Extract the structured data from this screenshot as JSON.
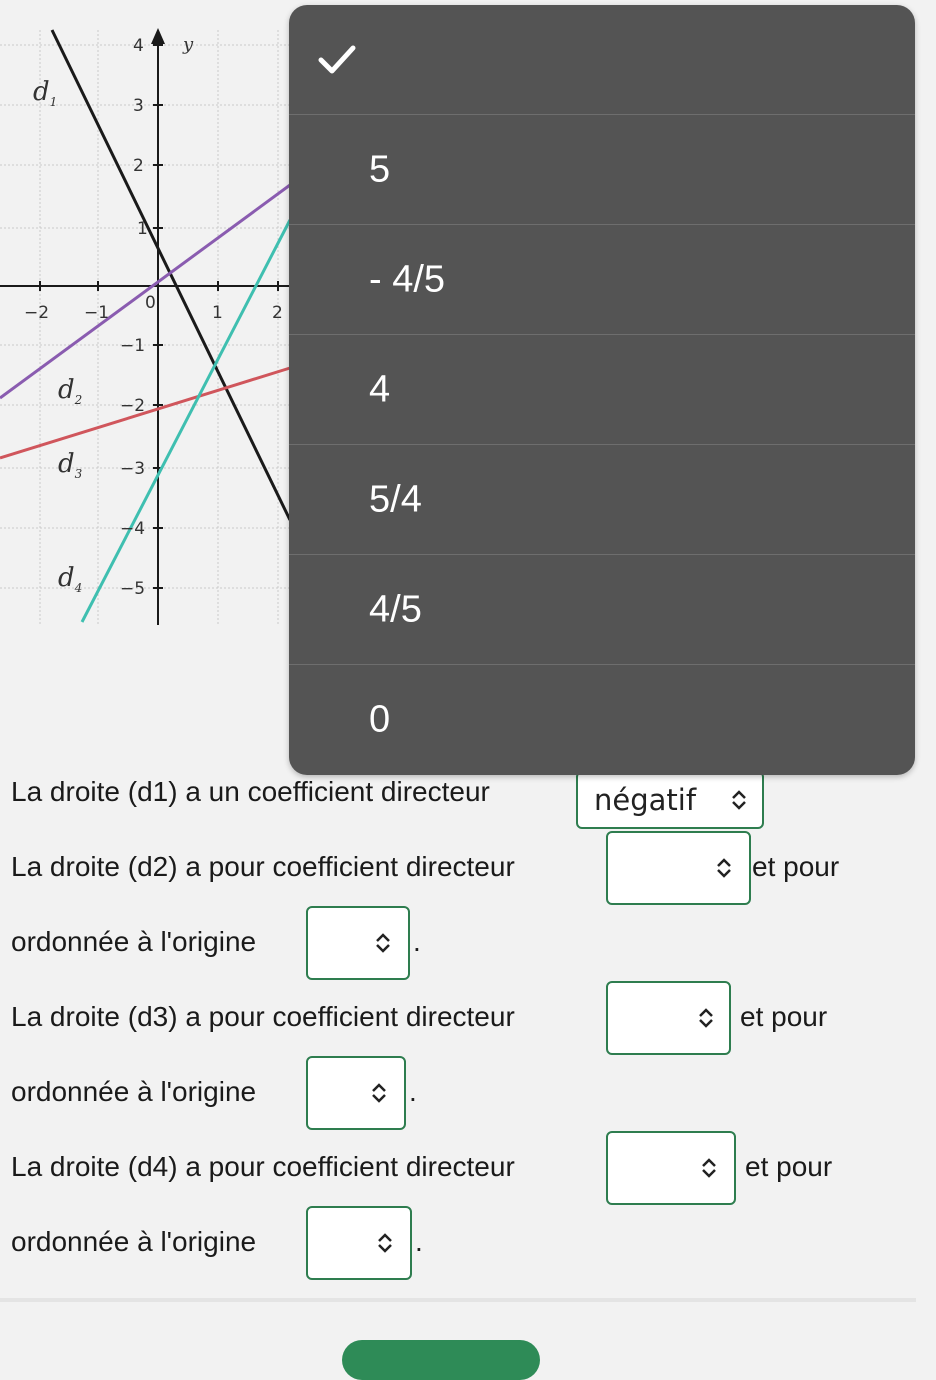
{
  "graph": {
    "y_axis_label": "y",
    "lines": [
      {
        "label": "d",
        "sub": "1",
        "color": "#1a1a1a"
      },
      {
        "label": "d",
        "sub": "2",
        "color": "#8a5cb0"
      },
      {
        "label": "d",
        "sub": "3",
        "color": "#d0565c"
      },
      {
        "label": "d",
        "sub": "4",
        "color": "#3fbfb0"
      }
    ],
    "x_ticks": [
      "−2",
      "−1",
      "0",
      "1",
      "2"
    ],
    "y_ticks": [
      "4",
      "3",
      "2",
      "1",
      "−1",
      "−2",
      "−3",
      "−4",
      "−5"
    ]
  },
  "dropdown": {
    "options": [
      "",
      "5",
      "- 4/5",
      "4",
      "5/4",
      "4/5",
      "0"
    ],
    "selected_index": 0
  },
  "questions": {
    "d1_text": "La droite (d1) a un coefficient directeur",
    "d1_value": "négatif",
    "d2_text": "La droite (d2) a pour coefficient directeur",
    "d2_after": "et pour",
    "d2_origin": "ordonnée à l'origine",
    "d3_text": "La droite (d3) a pour coefficient directeur",
    "d3_after": "et pour",
    "d3_origin": "ordonnée à l'origine",
    "d4_text": "La droite (d4) a pour coefficient directeur",
    "d4_after": "et pour",
    "d4_origin": "ordonnée à l'origine",
    "period": "."
  },
  "colors": {
    "accent": "#2e7d4f",
    "menu_bg": "#545454"
  }
}
